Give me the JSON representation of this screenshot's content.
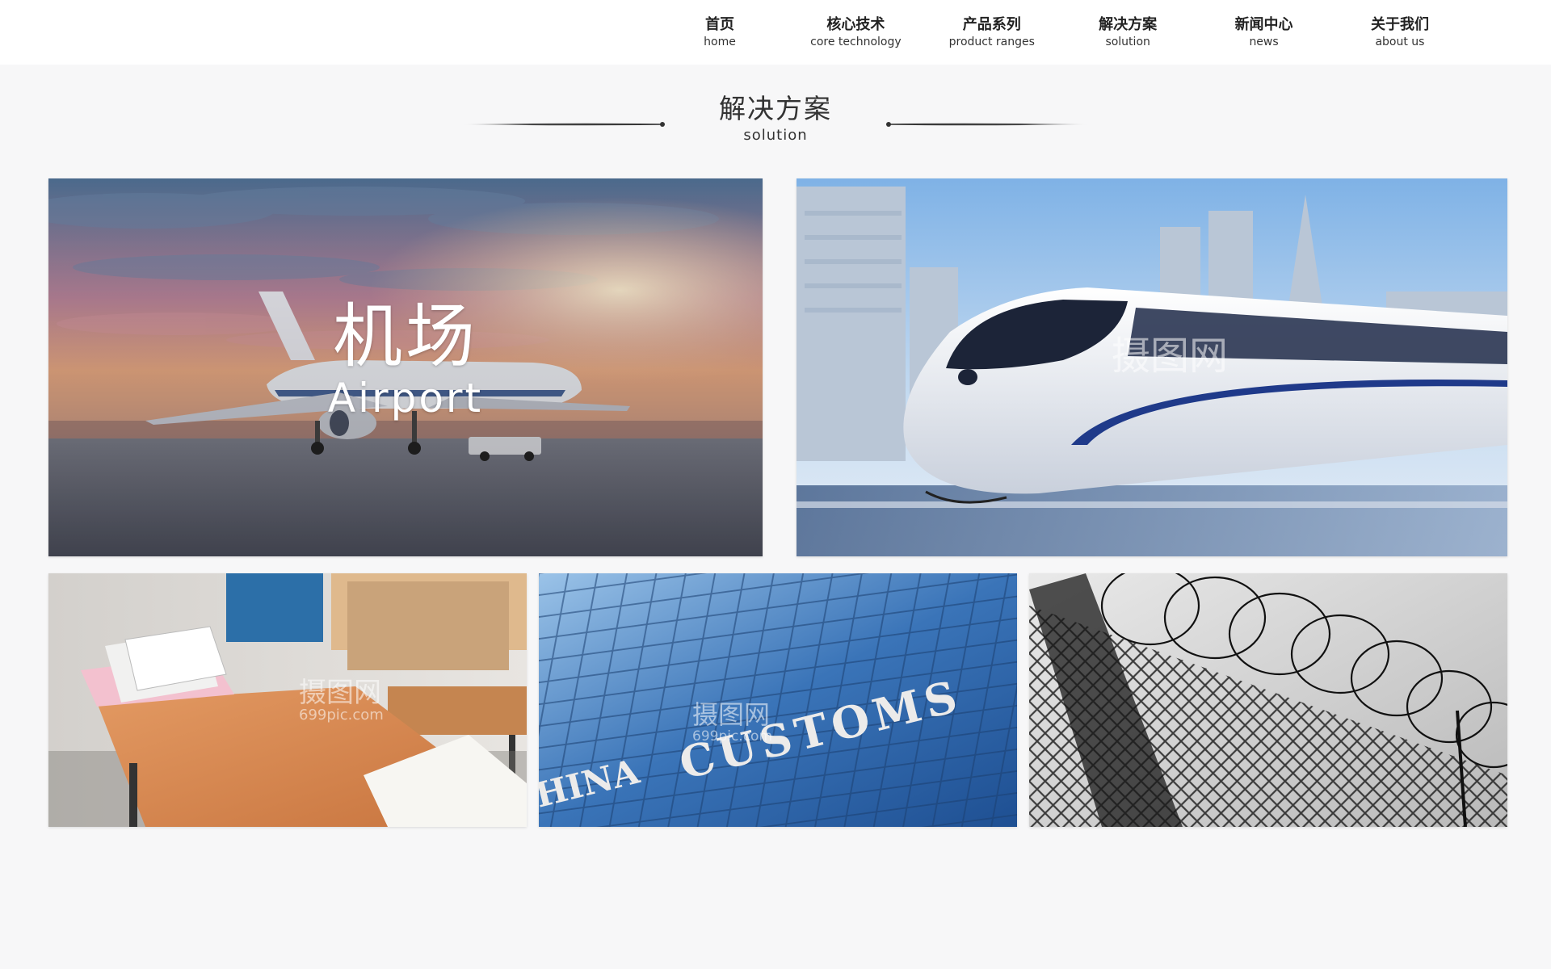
{
  "nav": {
    "items": [
      {
        "cn": "首页",
        "en": "home"
      },
      {
        "cn": "核心技术",
        "en": "core technology"
      },
      {
        "cn": "产品系列",
        "en": "product ranges"
      },
      {
        "cn": "解决方案",
        "en": "solution"
      },
      {
        "cn": "新闻中心",
        "en": "news"
      },
      {
        "cn": "关于我们",
        "en": "about us"
      }
    ]
  },
  "section": {
    "title_cn": "解决方案",
    "title_en": "solution"
  },
  "cards": {
    "airport": {
      "cn": "机场",
      "en": "Airport"
    },
    "customs": {
      "sign_en": "CUSTOMS",
      "sign_prefix": "HINA"
    },
    "watermark": {
      "brand": "摄图网",
      "site": "699pic.com"
    }
  },
  "colors": {
    "header_bg": "#ffffff",
    "page_bg": "#f7f7f8",
    "text": "#222222",
    "deco_line": "#333333"
  }
}
